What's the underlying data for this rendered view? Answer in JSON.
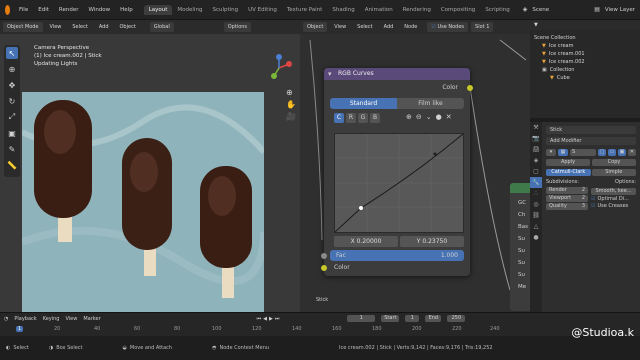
{
  "menubar": {
    "items": [
      "File",
      "Edit",
      "Render",
      "Window",
      "Help"
    ],
    "workspaces": [
      "Layout",
      "Modeling",
      "Sculpting",
      "UV Editing",
      "Texture Paint",
      "Shading",
      "Animation",
      "Rendering",
      "Compositing",
      "Scripting"
    ],
    "active_workspace": "Layout",
    "scene": "Scene",
    "view_layer": "View Layer"
  },
  "viewport": {
    "mode": "Object Mode",
    "menus": [
      "View",
      "Select",
      "Add",
      "Object"
    ],
    "transform": "Global",
    "options": "Options",
    "overlay_lines": [
      "Camera Perspective",
      "(1) Ice cream.002 | Stick",
      "Updating Lights"
    ]
  },
  "node_editor": {
    "type": "Object",
    "menus": [
      "View",
      "Select",
      "Add",
      "Node"
    ],
    "use_nodes_label": "Use Nodes",
    "slot": "Slot 1",
    "node": {
      "title": "RGB Curves",
      "output_label": "Color",
      "tabs": [
        "Standard",
        "Film like"
      ],
      "channels": [
        "C",
        "R",
        "G",
        "B"
      ],
      "x_value": "X 0.20000",
      "y_value": "Y 0.23750",
      "fac_label": "Fac",
      "fac_value": "1.000",
      "input_label": "Color"
    },
    "side_labels": [
      "GC",
      "Ch",
      "Bas",
      "Su",
      "Su",
      "Su",
      "Su",
      "Me"
    ],
    "object_label": "Stick"
  },
  "outliner": {
    "root": "Scene Collection",
    "items": [
      "Ice cream",
      "Ice cream.001",
      "Ice cream.002",
      "Collection",
      "Cube"
    ]
  },
  "properties": {
    "object_name": "Stick",
    "add_modifier": "Add Modifier",
    "apply": "Apply",
    "copy": "Copy",
    "modes": [
      "Catmull-Clark",
      "Simple"
    ],
    "subdivisions_label": "Subdivisions:",
    "options_label": "Options:",
    "render_label": "Render",
    "render_value": "2",
    "viewport_label": "Viewport",
    "viewport_value": "2",
    "quality_label": "Quality",
    "quality_value": "3",
    "smooth_label": "Smooth, kee...",
    "optimal_label": "Optimal Di...",
    "use_creases": "Use Creases"
  },
  "timeline": {
    "menus": [
      "Playback",
      "Keying",
      "View",
      "Marker"
    ],
    "current_frame": "1",
    "start_label": "Start",
    "start": "1",
    "end_label": "End",
    "end": "250",
    "ticks": [
      "1",
      "20",
      "40",
      "60",
      "80",
      "100",
      "120",
      "140",
      "160",
      "180",
      "200",
      "220",
      "240"
    ]
  },
  "statusbar": {
    "select": "Select",
    "box_select": "Box Select",
    "move": "Move and Attach",
    "context_menu": "Node Context Menu",
    "stats": "Ice cream.002 | Stick | Verts:9,142 | Faces:9,176 | Tris:19,252"
  },
  "watermark": "@Studioa.k",
  "colors": {
    "accent": "#4772b3",
    "node_header": "#5a4a7a",
    "socket_yellow": "#c7c729",
    "socket_purple": "#6363c7",
    "chocolate": "#3a1e14"
  }
}
